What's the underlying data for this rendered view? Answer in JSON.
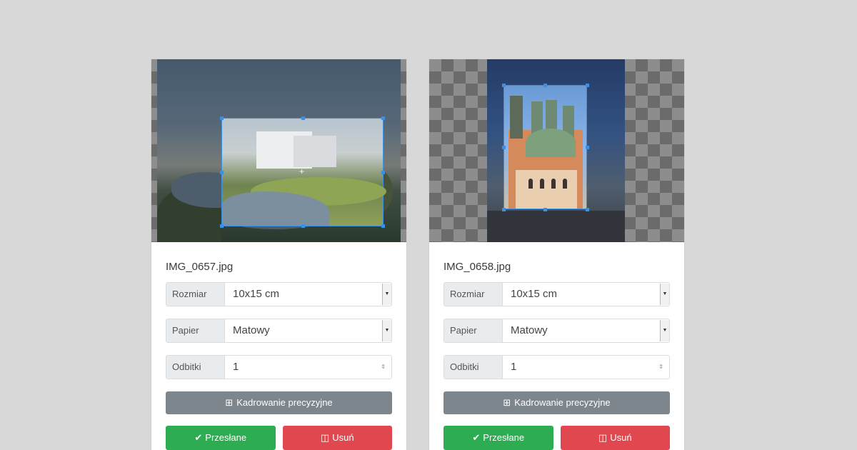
{
  "cards": [
    {
      "filename": "IMG_0657.jpg",
      "size_label": "Rozmiar",
      "size_value": "10x15 cm",
      "paper_label": "Papier",
      "paper_value": "Matowy",
      "copies_label": "Odbitki",
      "copies_value": "1",
      "crop_button": "Kadrowanie precyzyjne",
      "uploaded_button": "Przesłane",
      "delete_button": "Usuń"
    },
    {
      "filename": "IMG_0658.jpg",
      "size_label": "Rozmiar",
      "size_value": "10x15 cm",
      "paper_label": "Papier",
      "paper_value": "Matowy",
      "copies_label": "Odbitki",
      "copies_value": "1",
      "crop_button": "Kadrowanie precyzyjne",
      "uploaded_button": "Przesłane",
      "delete_button": "Usuń"
    }
  ],
  "icons": {
    "crop": "crop-icon",
    "check": "check-icon",
    "trash": "trash-icon",
    "dropdown": "dropdown-arrow-icon",
    "spinner": "spinner-arrows-icon",
    "move": "crosshair-icon"
  },
  "colors": {
    "background": "#d8d8d8",
    "crop_frame": "#3d8fe0",
    "crop_button": "#7d858d",
    "uploaded_button": "#2dac52",
    "delete_button": "#e0474f",
    "addon": "#e9ecef"
  }
}
